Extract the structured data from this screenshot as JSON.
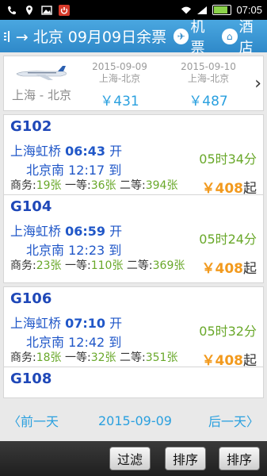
{
  "status_bar": {
    "time": "07:05",
    "icons": [
      "phone-icon",
      "location-icon",
      "image-icon",
      "power-icon",
      "wifi-icon",
      "signal-icon",
      "battery-icon"
    ]
  },
  "header": {
    "title": "→ 北京 09月09日余票",
    "tab_flight": "机票",
    "tab_hotel": "酒店"
  },
  "price_strip": {
    "route": "上海 - 北京",
    "items": [
      {
        "date": "2015-09-09",
        "route": "上海-北京",
        "price": "￥431"
      },
      {
        "date": "2015-09-10",
        "route": "上海-北京",
        "price": "￥487"
      }
    ]
  },
  "trains": [
    {
      "number": "G102",
      "dep_station": "上海虹桥",
      "dep_time": "06:43",
      "dep_suffix": "开",
      "arr_station": "北京南",
      "arr_time": "12:17",
      "arr_suffix": "到",
      "duration": "05时34分",
      "seat_biz_label": "商务:",
      "seat_biz": "19张",
      "seat_first_label": "一等:",
      "seat_first": "36张",
      "seat_second_label": "二等:",
      "seat_second": "394张",
      "price_symbol": "￥",
      "price": "408",
      "price_suffix": "起"
    },
    {
      "number": "G104",
      "dep_station": "上海虹桥",
      "dep_time": "06:59",
      "dep_suffix": "开",
      "arr_station": "北京南",
      "arr_time": "12:23",
      "arr_suffix": "到",
      "duration": "05时24分",
      "seat_biz_label": "商务:",
      "seat_biz": "23张",
      "seat_first_label": "一等:",
      "seat_first": "110张",
      "seat_second_label": "二等:",
      "seat_second": "369张",
      "price_symbol": "￥",
      "price": "408",
      "price_suffix": "起"
    },
    {
      "number": "G106",
      "dep_station": "上海虹桥",
      "dep_time": "07:10",
      "dep_suffix": "开",
      "arr_station": "北京南",
      "arr_time": "12:42",
      "arr_suffix": "到",
      "duration": "05时32分",
      "seat_biz_label": "商务:",
      "seat_biz": "18张",
      "seat_first_label": "一等:",
      "seat_first": "32张",
      "seat_second_label": "二等:",
      "seat_second": "351张",
      "price_symbol": "￥",
      "price": "408",
      "price_suffix": "起"
    },
    {
      "number": "G108"
    }
  ],
  "date_nav": {
    "prev": "前一天",
    "date": "2015-09-09",
    "next": "后一天"
  },
  "bottom_bar": {
    "filter": "过滤",
    "sort1": "排序",
    "sort2": "排序"
  },
  "colors": {
    "header_blue": "#2f89c9",
    "train_number": "#1f48b8",
    "station_blue": "#2057c8",
    "duration_green": "#69a82a",
    "price_orange": "#f29a1e",
    "link_blue": "#2aa0df"
  }
}
